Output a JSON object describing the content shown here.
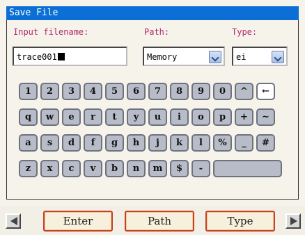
{
  "window": {
    "title": "Save File"
  },
  "labels": {
    "filename": "Input filename:",
    "path": "Path:",
    "type": "Type:"
  },
  "filename": {
    "value": "trace001"
  },
  "path": {
    "selected": "Memory"
  },
  "type": {
    "selected": "ei"
  },
  "keyboard": {
    "rows": [
      [
        "1",
        "2",
        "3",
        "4",
        "5",
        "6",
        "7",
        "8",
        "9",
        "0",
        "^",
        "←"
      ],
      [
        "q",
        "w",
        "e",
        "r",
        "t",
        "y",
        "u",
        "i",
        "o",
        "p",
        "+",
        "~"
      ],
      [
        "a",
        "s",
        "d",
        "f",
        "g",
        "h",
        "j",
        "k",
        "l",
        "%",
        "_",
        "#"
      ],
      [
        "z",
        "x",
        "c",
        "v",
        "b",
        "n",
        "m",
        "$",
        "-",
        ""
      ]
    ],
    "selected_key": "←"
  },
  "softkeys": {
    "enter": "Enter",
    "path": "Path",
    "type": "Type"
  },
  "icons": {
    "prev": "left-arrow-icon",
    "next": "right-arrow-icon",
    "dropdown": "chevron-down-icon"
  },
  "colors": {
    "title_bar": "#0b6fd6",
    "label": "#b0286e",
    "softkey_border": "#c8401e",
    "key": "#b8bcc8"
  }
}
